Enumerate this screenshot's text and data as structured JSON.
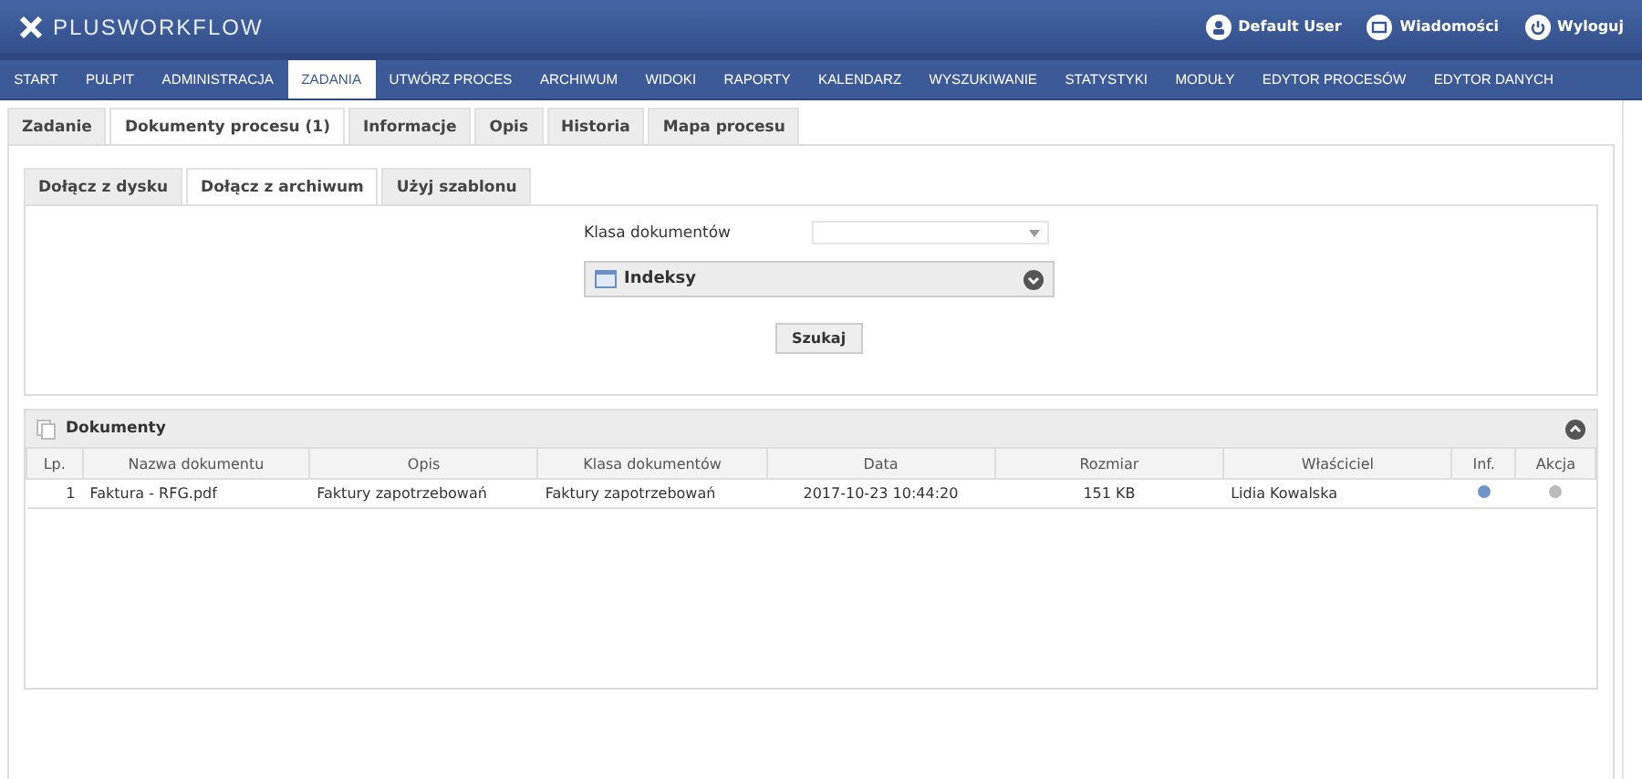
{
  "logo": "PLUSWORKFLOW",
  "user_links": [
    {
      "kind": "user",
      "label": "Default User"
    },
    {
      "kind": "mail",
      "label": "Wiadomości"
    },
    {
      "kind": "power",
      "label": "Wyloguj"
    }
  ],
  "nav": [
    {
      "label": "START",
      "selected": false
    },
    {
      "label": "PULPIT",
      "selected": false
    },
    {
      "label": "ADMINISTRACJA",
      "selected": false
    },
    {
      "label": "ZADANIA",
      "selected": true
    },
    {
      "label": "UTWÓRZ PROCES",
      "selected": false
    },
    {
      "label": "ARCHIWUM",
      "selected": false
    },
    {
      "label": "WIDOKI",
      "selected": false
    },
    {
      "label": "RAPORTY",
      "selected": false
    },
    {
      "label": "KALENDARZ",
      "selected": false
    },
    {
      "label": "WYSZUKIWANIE",
      "selected": false
    },
    {
      "label": "STATYSTYKI",
      "selected": false
    },
    {
      "label": "MODUŁY",
      "selected": false
    },
    {
      "label": "EDYTOR PROCESÓW",
      "selected": false
    },
    {
      "label": "EDYTOR DANYCH",
      "selected": false
    }
  ],
  "tabs": [
    {
      "label": "Zadanie",
      "selected": false
    },
    {
      "label": "Dokumenty procesu (1)",
      "selected": true
    },
    {
      "label": "Informacje",
      "selected": false
    },
    {
      "label": "Opis",
      "selected": false
    },
    {
      "label": "Historia",
      "selected": false
    },
    {
      "label": "Mapa procesu",
      "selected": false
    }
  ],
  "subtabs": [
    {
      "label": "Dołącz z dysku",
      "selected": false
    },
    {
      "label": "Dołącz z archiwum",
      "selected": true
    },
    {
      "label": "Użyj szablonu",
      "selected": false
    }
  ],
  "search": {
    "class_label": "Klasa dokumentów",
    "indexes_title": "Indeksy",
    "button": "Szukaj"
  },
  "documents": {
    "title": "Dokumenty",
    "columns": [
      "Lp.",
      "Nazwa dokumentu",
      "Opis",
      "Klasa dokumentów",
      "Data",
      "Rozmiar",
      "Właściciel",
      "Inf.",
      "Akcja"
    ],
    "rows": [
      {
        "lp": "1",
        "name": "Faktura - RFG.pdf",
        "description": "Faktury zapotrzebowań",
        "class": "Faktury zapotrzebowań",
        "date": "2017-10-23 10:44:20",
        "size": "151 KB",
        "owner": "Lidia Kowalska"
      }
    ]
  }
}
